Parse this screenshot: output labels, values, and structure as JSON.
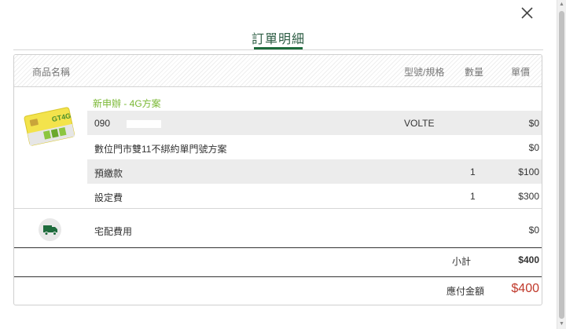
{
  "dialog": {
    "title": "訂單明細",
    "close_icon": "close-icon"
  },
  "table": {
    "headers": {
      "product": "商品名稱",
      "model": "型號/規格",
      "qty": "數量",
      "price": "單價"
    },
    "plan_name": "新申辦 - 4G方案",
    "product_image_label": "GT4G",
    "rows": [
      {
        "name": "090",
        "model": "VOLTE",
        "qty": "",
        "price": "$0"
      },
      {
        "name": "數位門市雙11不綁約單門號方案",
        "model": "",
        "qty": "",
        "price": "$0"
      },
      {
        "name": "預繳款",
        "model": "",
        "qty": "1",
        "price": "$100"
      },
      {
        "name": "設定費",
        "model": "",
        "qty": "1",
        "price": "$300"
      }
    ],
    "delivery": {
      "name": "宅配費用",
      "price": "$0",
      "icon": "truck-icon"
    },
    "subtotal": {
      "label": "小計",
      "value": "$400"
    },
    "total": {
      "label": "應付金額",
      "value": "$400"
    }
  },
  "colors": {
    "brand_green": "#1e6b3c",
    "plan_green": "#7ab834",
    "total_red": "#c0392b"
  }
}
